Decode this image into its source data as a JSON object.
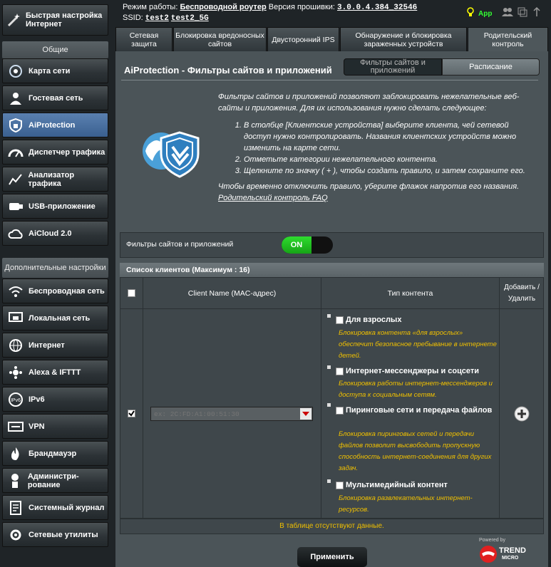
{
  "sidebar": {
    "quick": "Быстрая настройка Интернет",
    "general_header": "Общие",
    "general": [
      {
        "label": "Карта сети",
        "icon": "network-map-icon"
      },
      {
        "label": "Гостевая сеть",
        "icon": "guest-network-icon"
      },
      {
        "label": "AiProtection",
        "icon": "aiprotection-icon"
      },
      {
        "label": "Диспетчер трафика",
        "icon": "traffic-manager-icon"
      },
      {
        "label": "Анализатор трафика",
        "icon": "traffic-analyzer-icon"
      },
      {
        "label": "USB-приложение",
        "icon": "usb-icon"
      },
      {
        "label": "AiCloud 2.0",
        "icon": "cloud-icon"
      }
    ],
    "advanced_header": "Дополнительные настройки",
    "advanced": [
      {
        "label": "Беспроводная сеть",
        "icon": "wifi-icon"
      },
      {
        "label": "Локальная сеть",
        "icon": "lan-icon"
      },
      {
        "label": "Интернет",
        "icon": "globe-icon"
      },
      {
        "label": "Alexa & IFTTT",
        "icon": "alexa-icon"
      },
      {
        "label": "IPv6",
        "icon": "ipv6-icon"
      },
      {
        "label": "VPN",
        "icon": "vpn-icon"
      },
      {
        "label": "Брандмауэр",
        "icon": "firewall-icon"
      },
      {
        "label": "Администри-рование",
        "icon": "admin-icon"
      },
      {
        "label": "Системный журнал",
        "icon": "syslog-icon"
      },
      {
        "label": "Сетевые утилиты",
        "icon": "tools-icon"
      }
    ]
  },
  "topbar": {
    "mode_label": "Режим работы:",
    "mode_value": "Беспроводной роутер",
    "firmware_label": "Версия прошивки:",
    "firmware_value": "3.0.0.4.384_32546",
    "ssid_label": "SSID:",
    "ssid1": "test2",
    "ssid2": "test2_5G",
    "app_label": "App"
  },
  "tabs": [
    "Сетевая защита",
    "Блокировка вредоносных сайтов",
    "Двусторонний IPS",
    "Обнаружение и блокировка зараженных устройств",
    "Родительский контроль"
  ],
  "page": {
    "title": "AiProtection - Фильтры сайтов и приложений",
    "seg_filters": "Фильтры сайтов и приложений",
    "seg_schedule": "Расписание",
    "intro": "Фильтры сайтов и приложений позволяют заблокировать нежелательные веб-сайты и приложения. Для их использования нужно сделать следующее:",
    "steps": [
      "В столбце [Клиентские устройства] выберите клиента, чей сетевой доступ нужно контролировать. Названия клиентских устройств можно изменить на карте сети.",
      "Отметьте категории нежелательного контента.",
      "Щелкните по значку ( + ), чтобы создать правило, и затем сохраните его."
    ],
    "note": "Чтобы временно отключить правило, уберите флажок напротив его названия.",
    "faq": "Родительский контроль FAQ",
    "toggle_label": "Фильтры сайтов и приложений",
    "toggle_state": "ON",
    "list_title": "Список клиентов (Максимум : 16)",
    "col_name": "Client Name (MAC-адрес)",
    "col_type": "Тип контента",
    "col_add": "Добавить / Удалить",
    "mac_placeholder": "ex: 2C:FD:A1:00:51:30",
    "categories": [
      {
        "name": "Для взрослых",
        "desc": "Блокировка контента «для взрослых» обеспечит безопасное пребывание в интернете детей."
      },
      {
        "name": "Интернет-мессенджеры и соцсети",
        "desc": "Блокировка работы интернет-мессенджеров и доступа к социальным сетям."
      },
      {
        "name": "Пиринговые сети и передача файлов",
        "desc": "Блокировка пиринговых сетей и передачи файлов позволит высвободить пропускную способность интернет-соединения для других задач."
      },
      {
        "name": "Мультимедийный контент",
        "desc": "Блокировка развлекательных интернет-ресурсов."
      }
    ],
    "empty": "В таблице отсутствуют данные.",
    "apply": "Применить",
    "powered": "Powered by",
    "trend": "TREND",
    "micro": "MICRO"
  }
}
